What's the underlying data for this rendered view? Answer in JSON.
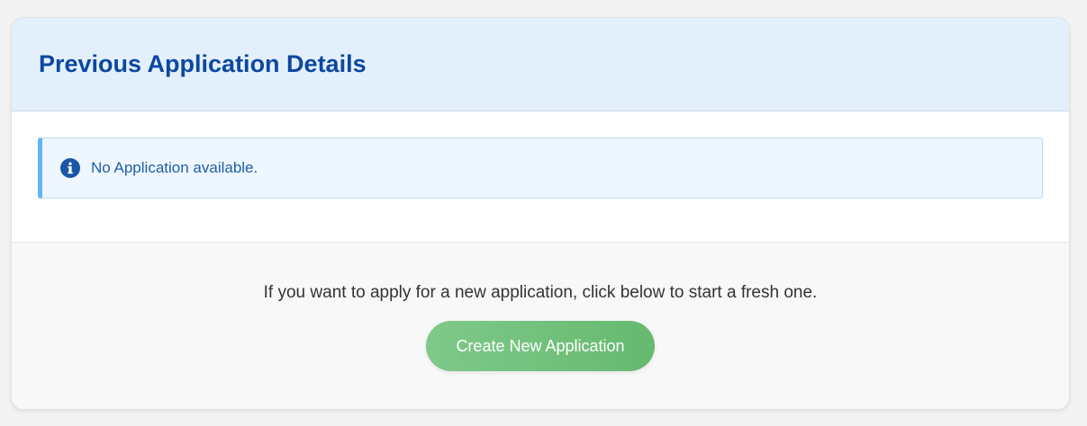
{
  "header": {
    "title": "Previous Application Details"
  },
  "alert": {
    "icon": "info-icon",
    "message": "No Application available."
  },
  "footer": {
    "prompt": "If you want to apply for a new application, click below to start a fresh one.",
    "create_button_label": "Create New Application"
  },
  "colors": {
    "title": "#0d47a1",
    "header_bg": "#e3f0fc",
    "alert_bg": "#eef7ff",
    "alert_accent": "#64b5f6",
    "button": "#6fbf78"
  }
}
